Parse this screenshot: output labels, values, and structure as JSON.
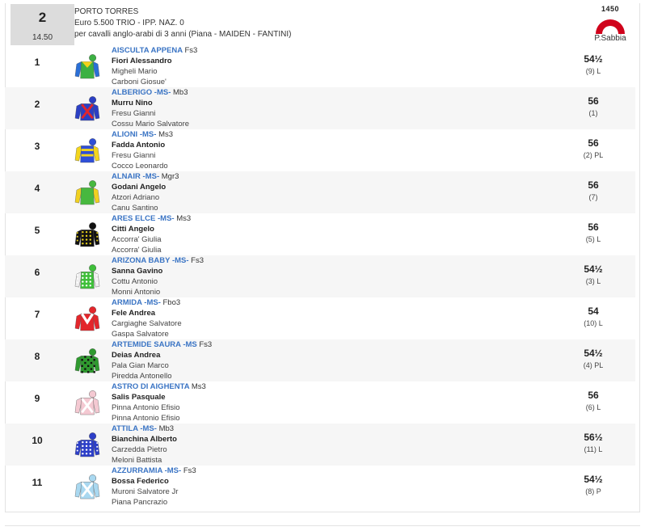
{
  "race": {
    "number": "2",
    "time": "14.50",
    "track": "PORTO TORRES",
    "prize": "Euro 5.500 TRIO - IPP. NAZ. 0",
    "conditions": "per cavalli anglo-arabi di 3 anni (Piana -  MAIDEN  - FANTINI)",
    "distance": "1450",
    "surface": "P.Sabbia",
    "badge_color": "#d0021b"
  },
  "runners": [
    {
      "num": "1",
      "horse": "AISCULTA APPENA",
      "tag": "Fs3",
      "jockey": "Fiori Alessandro",
      "trainer": "Migheli Mario",
      "owner": "Carboni Giosue'",
      "weight": "54½",
      "draw": "(9) L",
      "silk": {
        "body": "#3cb043",
        "sleeve": "#2a6fd6",
        "cap": "#3cb043",
        "pattern": "yoke",
        "accent": "#f2d21a"
      }
    },
    {
      "num": "2",
      "horse": "ALBERIGO -MS-",
      "tag": "Mb3",
      "jockey": "Murru Nino",
      "trainer": "Fresu Gianni",
      "owner": "Cossu Mario Salvatore",
      "weight": "56",
      "draw": "(1)",
      "silk": {
        "body": "#2b3fc4",
        "sleeve": "#2b3fc4",
        "cap": "#2b3fc4",
        "pattern": "cross",
        "accent": "#e3262b"
      }
    },
    {
      "num": "3",
      "horse": "ALIONI -MS-",
      "tag": "Ms3",
      "jockey": "Fadda Antonio",
      "trainer": "Fresu Gianni",
      "owner": "Cocco Leonardo",
      "weight": "56",
      "draw": "(2) PL",
      "silk": {
        "body": "#2f4fd8",
        "sleeve": "#f3d51d",
        "cap": "#2f4fd8",
        "pattern": "hoops",
        "accent": "#f3d51d"
      }
    },
    {
      "num": "4",
      "horse": "ALNAIR -MS-",
      "tag": "Mgr3",
      "jockey": "Godani Angelo",
      "trainer": "Atzori Adriano",
      "owner": "Canu Santino",
      "weight": "56",
      "draw": "(7)",
      "silk": {
        "body": "#47b83f",
        "sleeve": "#f0d020",
        "cap": "#47b83f",
        "pattern": "plain",
        "accent": "#f0d020"
      }
    },
    {
      "num": "5",
      "horse": "ARES ELCE -MS-",
      "tag": "Ms3",
      "jockey": "Citti Angelo",
      "trainer": "Accorra' Giulia",
      "owner": "Accorra' Giulia",
      "weight": "56",
      "draw": "(5) L",
      "silk": {
        "body": "#111111",
        "sleeve": "#111111",
        "cap": "#111111",
        "pattern": "spots",
        "accent": "#e9d31c"
      }
    },
    {
      "num": "6",
      "horse": "ARIZONA BABY -MS-",
      "tag": "Fs3",
      "jockey": "Sanna Gavino",
      "trainer": "Cottu Antonio",
      "owner": "Monni Antonio",
      "weight": "54½",
      "draw": "(3) L",
      "silk": {
        "body": "#3fbf3a",
        "sleeve": "#eeeeee",
        "cap": "#3fbf3a",
        "pattern": "spots",
        "accent": "#ffffff"
      }
    },
    {
      "num": "7",
      "horse": "ARMIDA -MS-",
      "tag": "Fbo3",
      "jockey": "Fele Andrea",
      "trainer": "Cargiaghe Salvatore",
      "owner": "Gaspa Salvatore",
      "weight": "54",
      "draw": "(10) L",
      "silk": {
        "body": "#e3262b",
        "sleeve": "#e3262b",
        "cap": "#e3262b",
        "pattern": "chevron",
        "accent": "#ffffff"
      }
    },
    {
      "num": "8",
      "horse": "ARTEMIDE SAURA -MS",
      "tag": "Fs3",
      "jockey": "Deias Andrea",
      "trainer": "Pala Gian Marco",
      "owner": "Piredda Antonello",
      "weight": "54½",
      "draw": "(4) PL",
      "silk": {
        "body": "#2f9a2f",
        "sleeve": "#2f9a2f",
        "cap": "#2f9a2f",
        "pattern": "checks",
        "accent": "#111111"
      }
    },
    {
      "num": "9",
      "horse": "ASTRO DI AIGHENTA",
      "tag": "Ms3",
      "jockey": "Salis Pasquale",
      "trainer": "Pinna Antonio Efisio",
      "owner": "Pinna Antonio Efisio",
      "weight": "56",
      "draw": "(6) L",
      "silk": {
        "body": "#f4c9d2",
        "sleeve": "#f4c9d2",
        "cap": "#f4c9d2",
        "pattern": "cross",
        "accent": "#ffffff"
      }
    },
    {
      "num": "10",
      "horse": "ATTILA -MS-",
      "tag": "Mb3",
      "jockey": "Bianchina Alberto",
      "trainer": "Carzedda Pietro",
      "owner": "Meloni Battista",
      "weight": "56½",
      "draw": "(11) L",
      "silk": {
        "body": "#2d3fc8",
        "sleeve": "#2d3fc8",
        "cap": "#2d3fc8",
        "pattern": "spots",
        "accent": "#ffffff"
      }
    },
    {
      "num": "11",
      "horse": "AZZURRAMIA -MS-",
      "tag": "Fs3",
      "jockey": "Bossa Federico",
      "trainer": "Muroni Salvatore Jr",
      "owner": "Piana Pancrazio",
      "weight": "54½",
      "draw": "(8) P",
      "silk": {
        "body": "#a9d8f0",
        "sleeve": "#a9d8f0",
        "cap": "#a9d8f0",
        "pattern": "cross",
        "accent": "#ffffff"
      }
    }
  ]
}
